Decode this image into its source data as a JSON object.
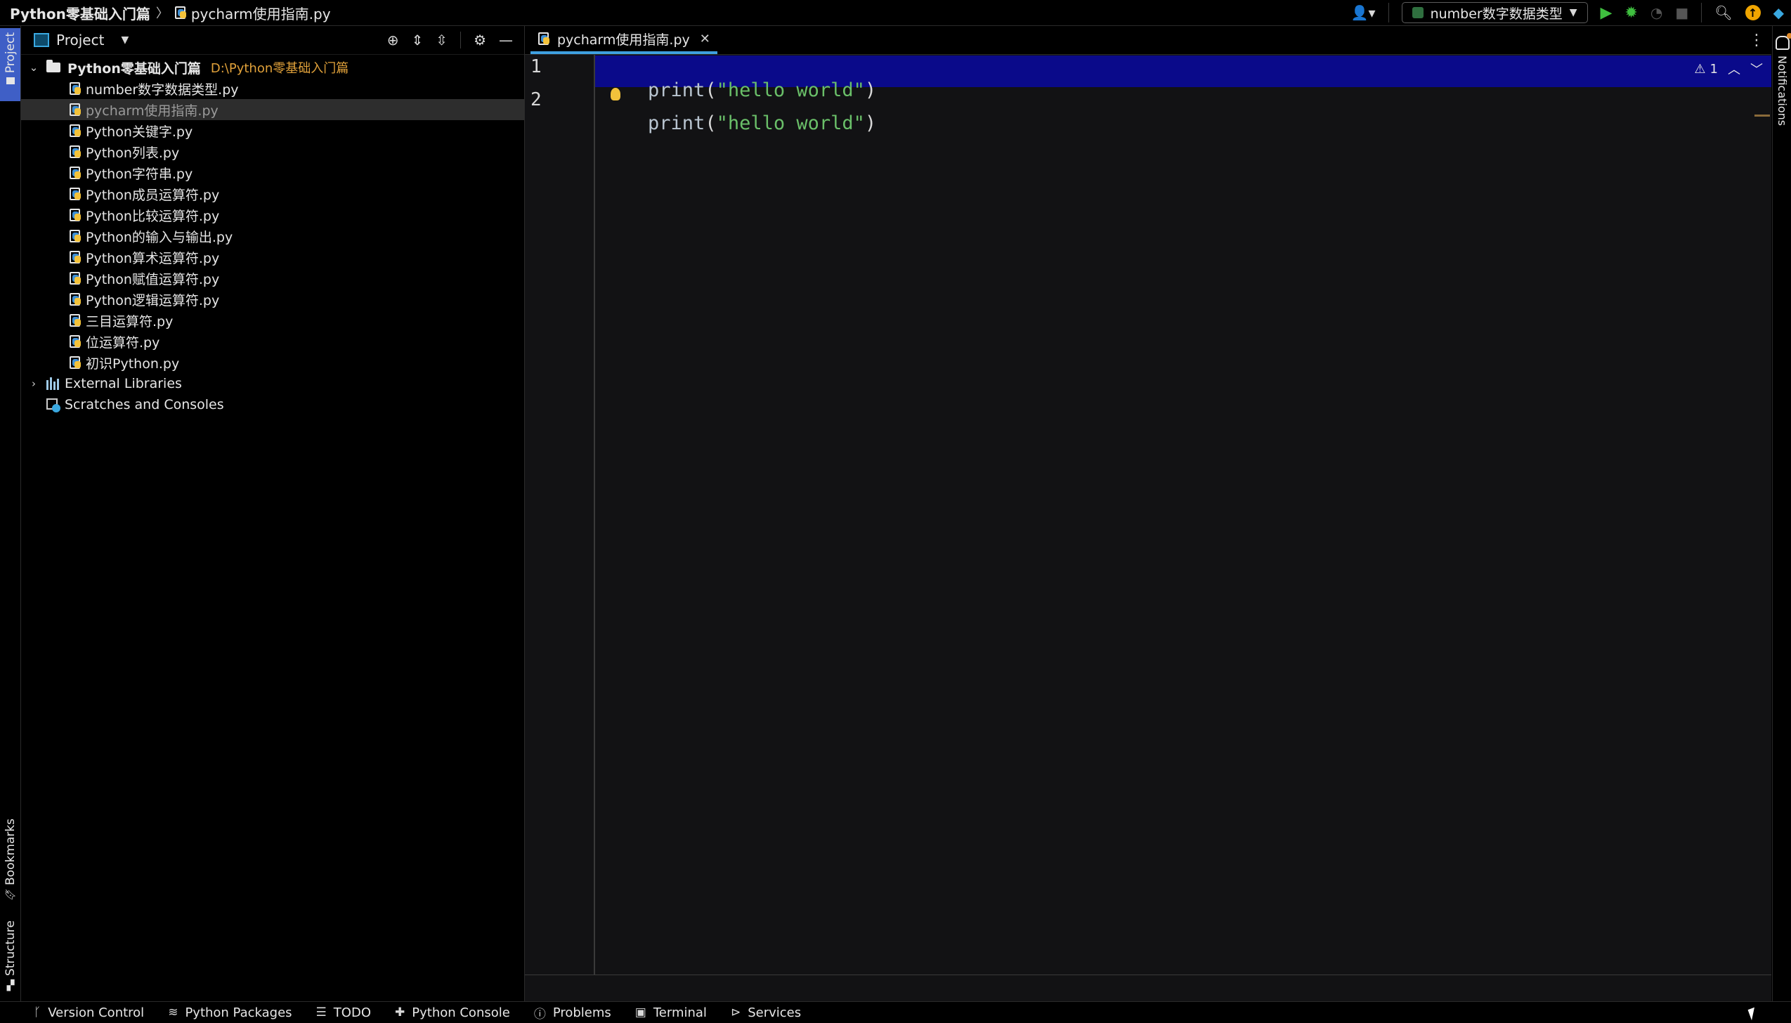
{
  "breadcrumb": {
    "root": "Python零基础入门篇",
    "file": "pycharm使用指南.py"
  },
  "toolbar": {
    "run_config": "number数字数据类型"
  },
  "project_panel": {
    "title": "Project",
    "root": {
      "name": "Python零基础入门篇",
      "path": "D:\\Python零基础入门篇"
    },
    "files": [
      "number数字数据类型.py",
      "pycharm使用指南.py",
      "Python关键字.py",
      "Python列表.py",
      "Python字符串.py",
      "Python成员运算符.py",
      "Python比较运算符.py",
      "Python的输入与输出.py",
      "Python算术运算符.py",
      "Python赋值运算符.py",
      "Python逻辑运算符.py",
      "三目运算符.py",
      "位运算符.py",
      "初识Python.py"
    ],
    "selected_file": "pycharm使用指南.py",
    "external_libraries": "External Libraries",
    "scratches": "Scratches and Consoles"
  },
  "left_stripe": {
    "project": "Project",
    "bookmarks": "Bookmarks",
    "structure": "Structure"
  },
  "editor": {
    "tab": "pycharm使用指南.py",
    "lines": [
      {
        "number": "1",
        "fn": "print",
        "open": "(",
        "str": "\"hello world\"",
        "close": ")"
      },
      {
        "number": "2",
        "fn": "print",
        "open": "(",
        "str": "\"hello world\"",
        "close": ")"
      }
    ],
    "warnings": "1"
  },
  "right_stripe": {
    "notifications": "Notifications"
  },
  "bottom_tools": [
    "Version Control",
    "Python Packages",
    "TODO",
    "Python Console",
    "Problems",
    "Terminal",
    "Services"
  ],
  "colors": {
    "accent": "#3f5fc6",
    "tab_underline": "#3fa0e0",
    "current_line": "#0a0a8a",
    "string": "#6abf69",
    "path": "#e0a13a"
  }
}
